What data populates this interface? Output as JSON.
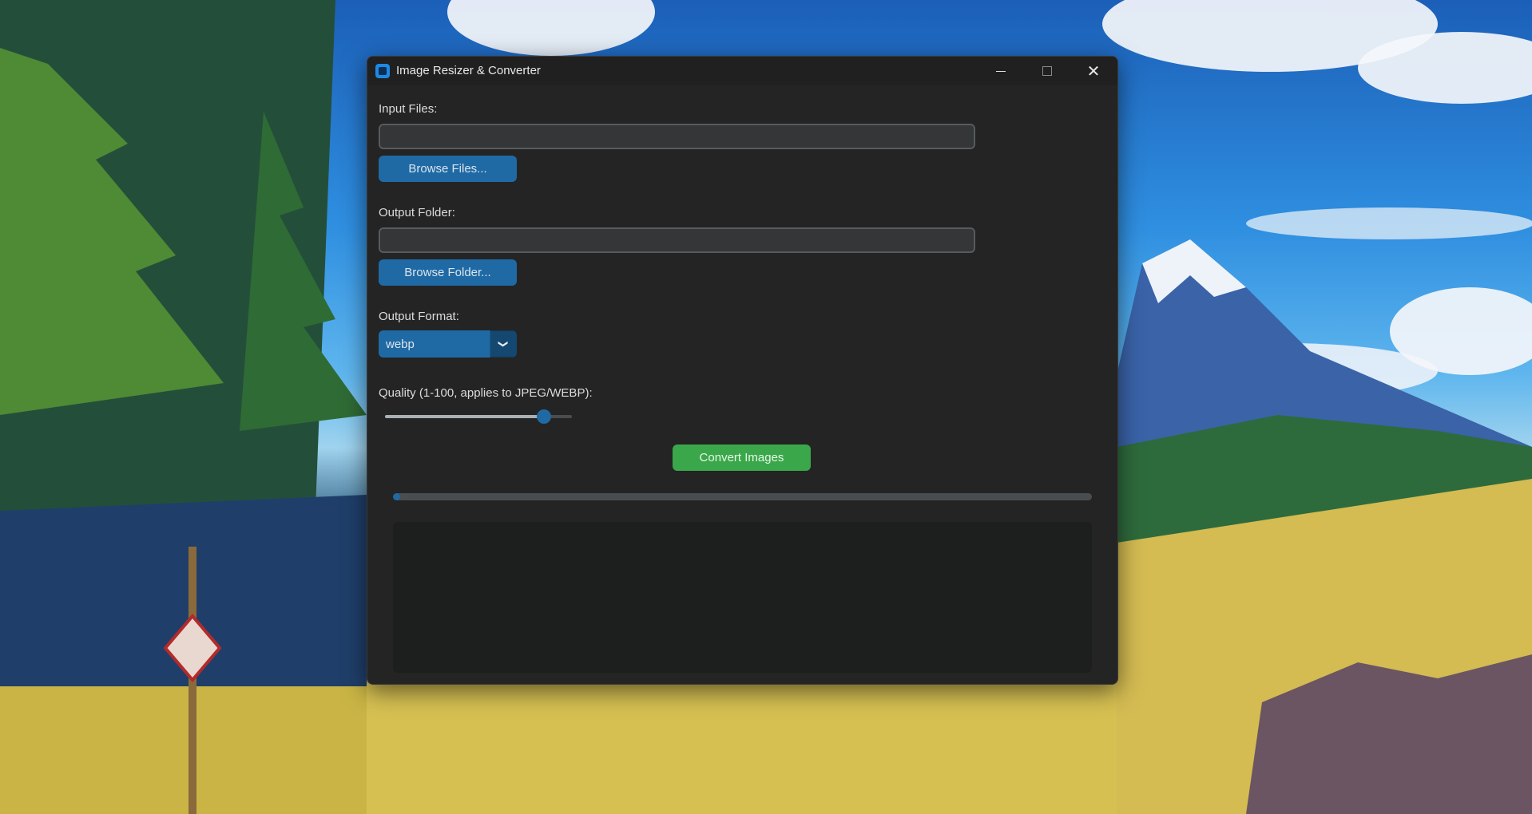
{
  "window": {
    "title": "Image Resizer & Converter",
    "icon": "app-logo-icon",
    "controls": {
      "minimize": "minimize-icon",
      "maximize": "maximize-icon",
      "close": "close-icon"
    }
  },
  "input_files": {
    "label": "Input Files:",
    "value": "",
    "browse_label": "Browse Files..."
  },
  "output_folder": {
    "label": "Output Folder:",
    "value": "",
    "browse_label": "Browse Folder..."
  },
  "output_format": {
    "label": "Output Format:",
    "selected": "webp",
    "arrow_icon": "chevron-down-icon"
  },
  "quality": {
    "label": "Quality (1-100, applies to JPEG/WEBP):",
    "min": 1,
    "max": 100,
    "value": 85
  },
  "convert": {
    "label": "Convert Images"
  },
  "progress": {
    "value": 0
  },
  "log": {
    "text": ""
  },
  "colors": {
    "accent": "#1f6aa5",
    "convert": "#3aa84a",
    "window_bg": "#242424",
    "field_bg": "#343638"
  }
}
